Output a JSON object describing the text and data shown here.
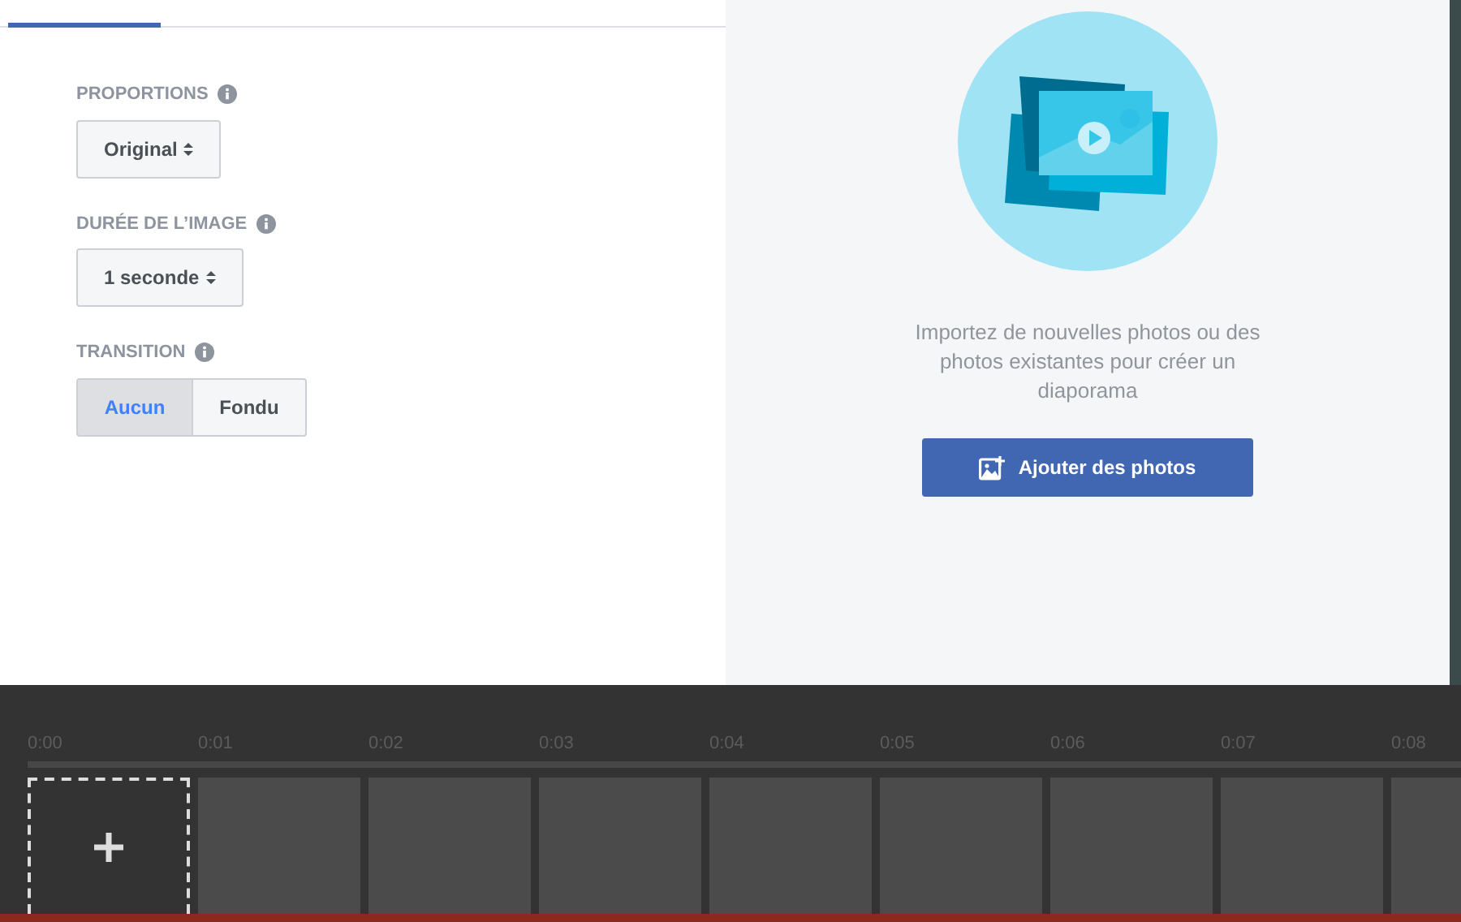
{
  "tabs": [
    {
      "selected": true
    }
  ],
  "settings": [
    {
      "kind": "select",
      "label": "PROPORTIONS",
      "value": "Original"
    },
    {
      "kind": "select",
      "label": "DURÉE DE L’IMAGE",
      "value": "1 seconde"
    },
    {
      "kind": "segmented",
      "label": "TRANSITION",
      "options": [
        {
          "label": "Aucun",
          "selected": true
        },
        {
          "label": "Fondu",
          "selected": false
        }
      ]
    }
  ],
  "empty_state": {
    "message": "Importez de nouvelles photos ou des photos existantes pour créer un diaporama",
    "button": "Ajouter des photos"
  },
  "timeline": {
    "ticks": [
      "0:00",
      "0:01",
      "0:02",
      "0:03",
      "0:04",
      "0:05",
      "0:06",
      "0:07",
      "0:08"
    ]
  }
}
